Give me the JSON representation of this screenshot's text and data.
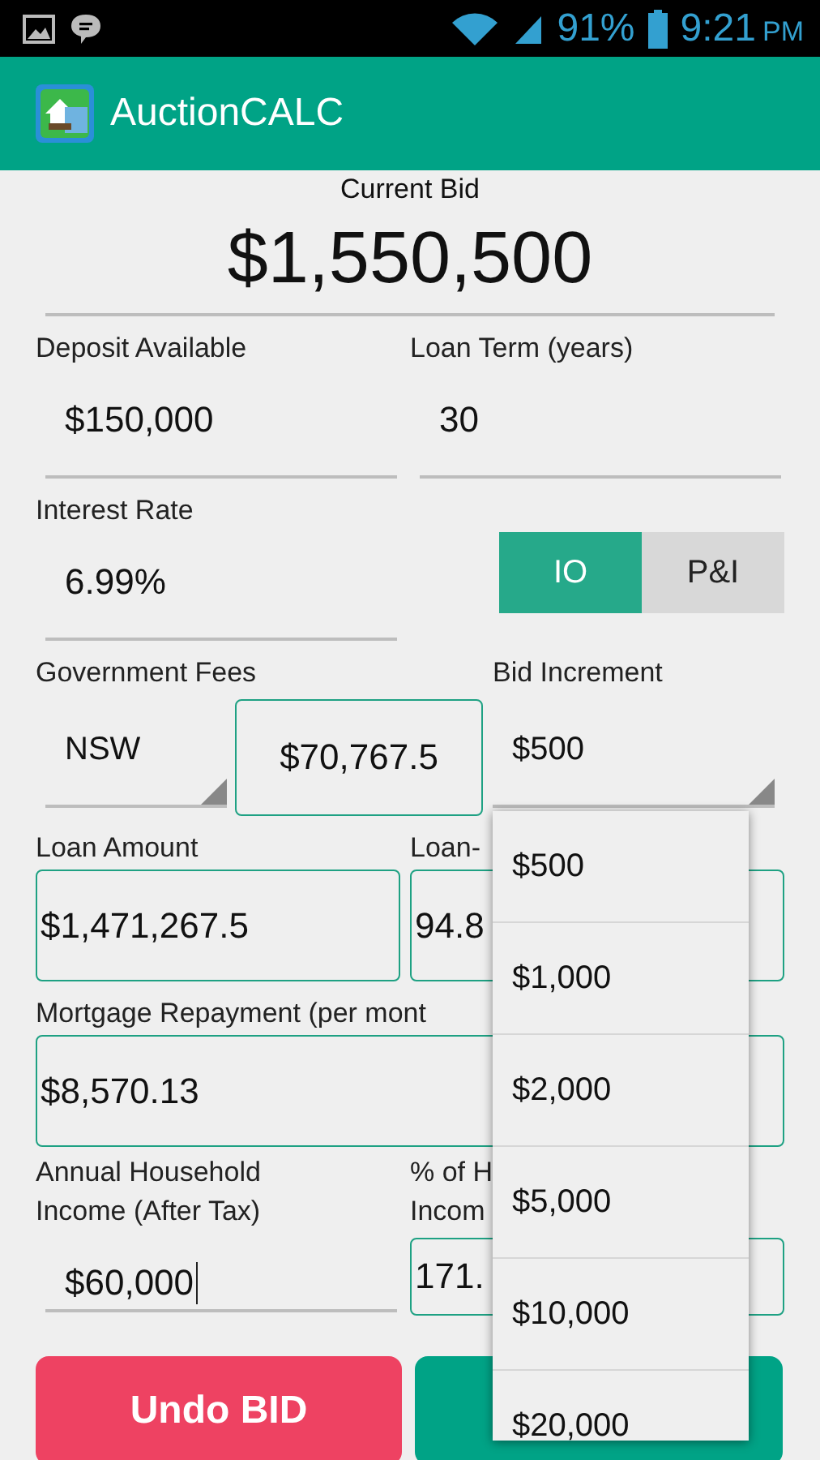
{
  "status_bar": {
    "battery": "91%",
    "time": "9:21",
    "ampm": "PM"
  },
  "app_bar": {
    "title": "AuctionCALC"
  },
  "current_bid": {
    "label": "Current Bid",
    "value": "$1,550,500"
  },
  "deposit": {
    "label": "Deposit Available",
    "value": "$150,000"
  },
  "loan_term": {
    "label": "Loan Term (years)",
    "value": "30"
  },
  "interest": {
    "label": "Interest Rate",
    "value": "6.99%"
  },
  "repayment_type": [
    {
      "label": "IO",
      "selected": true
    },
    {
      "label": "P&I",
      "selected": false
    }
  ],
  "government_fees": {
    "label": "Government Fees",
    "state": "NSW",
    "value": "$70,767.5"
  },
  "bid_increment": {
    "label": "Bid Increment",
    "value": "$500"
  },
  "loan_amount": {
    "label": "Loan Amount",
    "value": "$1,471,267.5"
  },
  "loan_to": {
    "label": "Loan-",
    "value": "94.8"
  },
  "mortgage": {
    "label": "Mortgage Repayment (per mont",
    "value": "$8,570.13"
  },
  "income": {
    "label": "Annual Household Income (After Tax)",
    "value": "$60,000",
    "focused": true
  },
  "income_share": {
    "label": "% of H\nIncom",
    "value": "171."
  },
  "buttons": [
    {
      "label": "Undo BID",
      "kind": "undo"
    },
    {
      "kind": "bid"
    }
  ],
  "increment_menu": [
    "$500",
    "$1,000",
    "$2,000",
    "$5,000",
    "$10,000",
    "$20,000"
  ]
}
